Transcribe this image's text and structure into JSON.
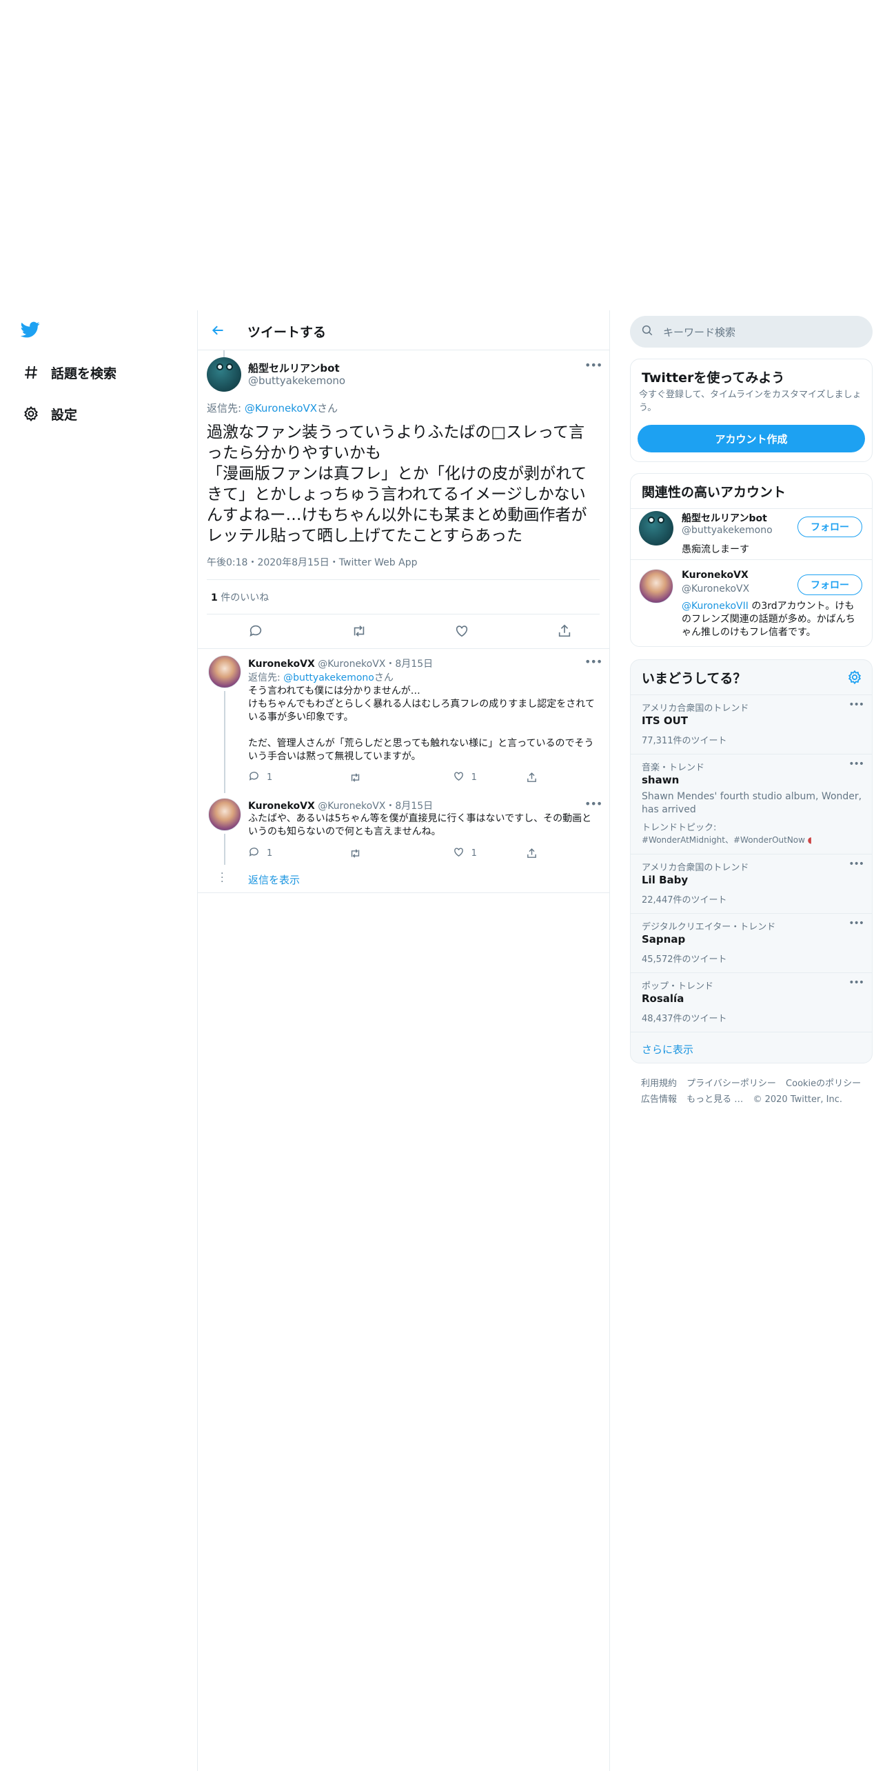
{
  "nav": {
    "explore_label": "話題を検索",
    "settings_label": "設定"
  },
  "header": {
    "title": "ツイートする"
  },
  "main_tweet": {
    "name": "船型セルリアンbot",
    "handle": "@buttyakekemono",
    "reply_prefix": "返信先: ",
    "reply_handle": "@KuronekoVX",
    "reply_suffix": "さん",
    "text": "過激なファン装うっていうよりふたばの□スレって言ったら分かりやすいかも\n「漫画版ファンは真フレ」とか「化けの皮が剥がれてきて」とかしょっちゅう言われてるイメージしかないんすよねー…けもちゃん以外にも某まとめ動画作者がレッテル貼って晒し上げてたことすらあった",
    "meta": "午後0:18・2020年8月15日・Twitter Web App",
    "likes_count": "1",
    "likes_label": " 件のいいね"
  },
  "replies": [
    {
      "name": "KuronekoVX",
      "handle": "@KuronekoVX・8月15日",
      "reply_prefix": "返信先: ",
      "reply_handle": "@buttyakekemono",
      "reply_suffix": "さん",
      "text": "そう言われても僕には分かりませんが…\nけもちゃんでもわざとらしく暴れる人はむしろ真フレの成りすまし認定をされている事が多い印象です。\n\nただ、管理人さんが「荒らしだと思っても触れない様に」と言っているのでそういう手合いは黙って無視していますが。",
      "reply_count": "1",
      "like_count": "1"
    },
    {
      "name": "KuronekoVX",
      "handle": "@KuronekoVX・8月15日",
      "text": "ふたばや、あるいは5ちゃん等を僕が直接見に行く事はないですし、その動画というのも知らないので何とも言えませんね。",
      "reply_count": "1",
      "like_count": "1"
    }
  ],
  "show_replies": "返信を表示",
  "search": {
    "placeholder": "キーワード検索"
  },
  "signup": {
    "title": "Twitterを使ってみよう",
    "desc": "今すぐ登録して、タイムラインをカスタマイズしましょう。",
    "button": "アカウント作成"
  },
  "related": {
    "title": "関連性の高いアカウント",
    "follow": "フォロー",
    "accounts": [
      {
        "name": "船型セルリアンbot",
        "handle": "@buttyakekemono",
        "bio": "愚痴流しまーす"
      },
      {
        "name": "KuronekoVX",
        "handle": "@KuronekoVX",
        "bio_link": "@KuronekoVII",
        "bio": " の3rdアカウント。けものフレンズ関連の話題が多め。かばんちゃん推しのけもフレ信者です。"
      }
    ]
  },
  "trends": {
    "title": "いまどうしてる？",
    "items": [
      {
        "context": "アメリカ合衆国のトレンド",
        "name": "ITS OUT",
        "count": "77,311件のツイート"
      },
      {
        "context": "音楽・トレンド",
        "name": "shawn",
        "desc": "Shawn Mendes' fourth studio album, Wonder, has arrived",
        "topic_label": "トレンドトピック:",
        "topics": "#WonderAtMidnight、#WonderOutNow"
      },
      {
        "context": "アメリカ合衆国のトレンド",
        "name": "Lil Baby",
        "count": "22,447件のツイート"
      },
      {
        "context": "デジタルクリエイター・トレンド",
        "name": "Sapnap",
        "count": "45,572件のツイート"
      },
      {
        "context": "ポップ・トレンド",
        "name": "Rosalía",
        "count": "48,437件のツイート"
      }
    ],
    "show_more": "さらに表示"
  },
  "footer": {
    "line1": [
      "利用規約",
      "プライバシーポリシー",
      "Cookieのポリシー"
    ],
    "line2": [
      "広告情報",
      "もっと見る …",
      "© 2020 Twitter, Inc."
    ]
  },
  "colors": {
    "accent": "#1da1f2",
    "link": "#1b95e0",
    "muted": "#657786",
    "border": "#e6ecf0"
  }
}
